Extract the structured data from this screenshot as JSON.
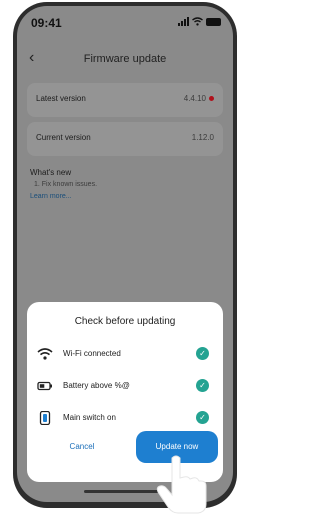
{
  "status_bar": {
    "time": "09:41"
  },
  "nav": {
    "title": "Firmware update"
  },
  "cards": [
    {
      "label": "Latest version",
      "value": "4.4.10",
      "has_dot": true
    },
    {
      "label": "Current version",
      "value": "1.12.0",
      "has_dot": false
    }
  ],
  "whats_new": {
    "title": "What's new",
    "items": [
      "1. Fix known issues."
    ],
    "link": "Learn more..."
  },
  "sheet": {
    "title": "Check before updating",
    "checks": [
      {
        "icon": "wifi-icon",
        "label": "Wi-Fi connected"
      },
      {
        "icon": "battery-icon",
        "label": "Battery above %@"
      },
      {
        "icon": "switch-icon",
        "label": "Main switch on"
      }
    ],
    "cancel_label": "Cancel",
    "update_label": "Update now"
  },
  "colors": {
    "accent": "#1e7fd0",
    "check": "#24a392",
    "alert_dot": "#b0111b",
    "overlay": "#8a8a8a"
  }
}
